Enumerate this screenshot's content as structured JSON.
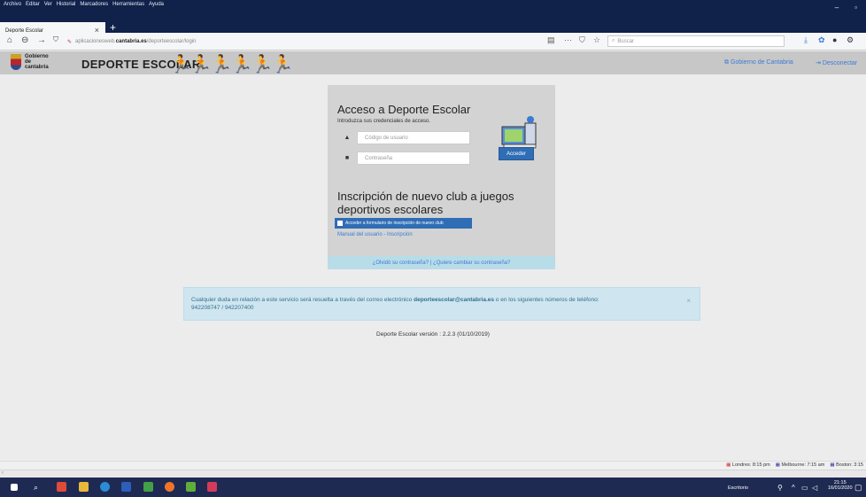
{
  "menubar": {
    "items": [
      "Archivo",
      "Editar",
      "Ver",
      "Historial",
      "Marcadores",
      "Herramientas",
      "Ayuda"
    ]
  },
  "tab": {
    "title": "Deporte Escolar"
  },
  "url": {
    "prefix": "aplicacionesweb.",
    "domain": "cantabria.es",
    "path": "/deporteescolar/login"
  },
  "search": {
    "placeholder": "Buscar"
  },
  "header": {
    "gov_lines": [
      "Gobierno",
      "de",
      "cantabria"
    ],
    "title": "DEPORTE ESCOLAR",
    "link_gobierno": "Gobierno de Cantabria",
    "link_desconectar": "Desconectar"
  },
  "login": {
    "title": "Acceso a Deporte Escolar",
    "hint": "Introduzca sus credenciales de acceso.",
    "user_placeholder": "Código de usuario",
    "pass_placeholder": "Contraseña",
    "submit": "Acceder"
  },
  "signup": {
    "title": "Inscripción de nuevo club a juegos deportivos escolares",
    "button": "Acceder a formulario de inscripción de nuevo club",
    "manual": "Manual del usuario - Inscripción"
  },
  "panel_footer": {
    "forgot": "¿Olvidó su contraseña?",
    "sep": " | ",
    "change": "¿Quiere cambiar su contraseña?"
  },
  "alert": {
    "text_before": "Cualquier duda en relación a este servicio será resuelta a través del correo electrónico ",
    "email": "deporteescolar@cantabria.es",
    "text_after": " o en los siguientes números de teléfono:",
    "phones": "942208747 / 942207400",
    "close": "×"
  },
  "version": "Deporte Escolar versión : 2.2.3 (01/10/2019)",
  "clocks": [
    "Londres: 8:15 pm",
    "Melbourne: 7:15 am",
    "Boston: 3:15"
  ],
  "taskbar": {
    "desktop_label": "Escritorio",
    "time": "21:15",
    "date": "16/01/2020"
  }
}
